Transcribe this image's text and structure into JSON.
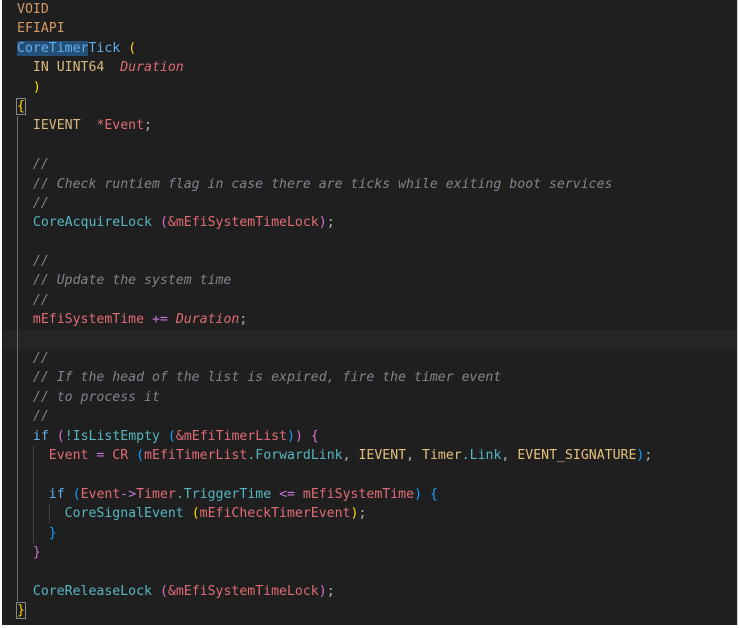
{
  "lines": [
    [
      {
        "t": "VOID",
        "c": "macro"
      }
    ],
    [
      {
        "t": "EFIAPI",
        "c": "macro"
      }
    ],
    [
      {
        "t": "CoreTimer",
        "c": "func-blue sel"
      },
      {
        "t": "Tick",
        "c": "func-blue"
      },
      {
        "t": " ",
        "c": "plain"
      },
      {
        "t": "(",
        "c": "punct-gold"
      }
    ],
    [
      {
        "t": "  IN UINT64  ",
        "c": "kw-type"
      },
      {
        "t": "Duration",
        "c": "param"
      }
    ],
    [
      {
        "t": "  ",
        "c": "plain"
      },
      {
        "t": ")",
        "c": "punct-gold"
      }
    ],
    [
      {
        "t": "{",
        "c": "punct-gold bracket-box"
      }
    ],
    [
      {
        "t": "  IEVENT  ",
        "c": "kw-type"
      },
      {
        "t": "*Event",
        "c": "var-red"
      },
      {
        "t": ";",
        "c": "plain"
      }
    ],
    [
      {
        "t": "",
        "c": "plain"
      }
    ],
    [
      {
        "t": "  //",
        "c": "comment"
      }
    ],
    [
      {
        "t": "  // Check runtiem flag in case there are ticks while exiting boot services",
        "c": "comment"
      }
    ],
    [
      {
        "t": "  //",
        "c": "comment"
      }
    ],
    [
      {
        "t": "  ",
        "c": "plain"
      },
      {
        "t": "CoreAcquireLock",
        "c": "func-teal"
      },
      {
        "t": " ",
        "c": "plain"
      },
      {
        "t": "(",
        "c": "punct-pink"
      },
      {
        "t": "&mEfiSystemTimeLock",
        "c": "var-red"
      },
      {
        "t": ")",
        "c": "punct-pink"
      },
      {
        "t": ";",
        "c": "plain"
      }
    ],
    [
      {
        "t": "",
        "c": "plain"
      }
    ],
    [
      {
        "t": "  //",
        "c": "comment"
      }
    ],
    [
      {
        "t": "  // Update the system time",
        "c": "comment"
      }
    ],
    [
      {
        "t": "  //",
        "c": "comment"
      }
    ],
    [
      {
        "t": "  ",
        "c": "plain"
      },
      {
        "t": "mEfiSystemTime",
        "c": "var-red"
      },
      {
        "t": " += ",
        "c": "op"
      },
      {
        "t": "Duration",
        "c": "param"
      },
      {
        "t": ";",
        "c": "plain"
      }
    ],
    [
      {
        "t": "",
        "c": "plain"
      }
    ],
    [
      {
        "t": "  //",
        "c": "comment"
      }
    ],
    [
      {
        "t": "  // If the head of the list is expired, fire the timer event",
        "c": "comment"
      }
    ],
    [
      {
        "t": "  // to process it",
        "c": "comment"
      }
    ],
    [
      {
        "t": "  //",
        "c": "comment"
      }
    ],
    [
      {
        "t": "  ",
        "c": "plain"
      },
      {
        "t": "if",
        "c": "func-blue"
      },
      {
        "t": " ",
        "c": "plain"
      },
      {
        "t": "(",
        "c": "punct-pink"
      },
      {
        "t": "!IsListEmpty",
        "c": "func-teal"
      },
      {
        "t": " ",
        "c": "plain"
      },
      {
        "t": "(",
        "c": "punct-blue"
      },
      {
        "t": "&mEfiTimerList",
        "c": "var-red"
      },
      {
        "t": ")",
        "c": "punct-blue"
      },
      {
        "t": ")",
        "c": "punct-pink"
      },
      {
        "t": " ",
        "c": "plain"
      },
      {
        "t": "{",
        "c": "punct-pink"
      }
    ],
    [
      {
        "t": "    ",
        "c": "plain"
      },
      {
        "t": "Event",
        "c": "var-red"
      },
      {
        "t": " = ",
        "c": "op"
      },
      {
        "t": "CR",
        "c": "var-red"
      },
      {
        "t": " ",
        "c": "plain"
      },
      {
        "t": "(",
        "c": "punct-blue"
      },
      {
        "t": "mEfiTimerList",
        "c": "var-red"
      },
      {
        "t": ".ForwardLink",
        "c": "func-teal"
      },
      {
        "t": ", ",
        "c": "plain"
      },
      {
        "t": "IEVENT",
        "c": "var"
      },
      {
        "t": ", ",
        "c": "plain"
      },
      {
        "t": "Timer",
        "c": "var"
      },
      {
        "t": ".Link",
        "c": "func-teal"
      },
      {
        "t": ", ",
        "c": "plain"
      },
      {
        "t": "EVENT_SIGNATURE",
        "c": "var"
      },
      {
        "t": ")",
        "c": "punct-blue"
      },
      {
        "t": ";",
        "c": "plain"
      }
    ],
    [
      {
        "t": "",
        "c": "plain"
      }
    ],
    [
      {
        "t": "    ",
        "c": "plain"
      },
      {
        "t": "if",
        "c": "func-blue"
      },
      {
        "t": " ",
        "c": "plain"
      },
      {
        "t": "(",
        "c": "punct-blue"
      },
      {
        "t": "Event",
        "c": "var-red"
      },
      {
        "t": "->",
        "c": "op"
      },
      {
        "t": "Timer",
        "c": "var-red"
      },
      {
        "t": ".TriggerTime",
        "c": "func-teal"
      },
      {
        "t": " <= ",
        "c": "op"
      },
      {
        "t": "mEfiSystemTime",
        "c": "var-red"
      },
      {
        "t": ")",
        "c": "punct-blue"
      },
      {
        "t": " ",
        "c": "plain"
      },
      {
        "t": "{",
        "c": "punct-blue"
      }
    ],
    [
      {
        "t": "      ",
        "c": "plain"
      },
      {
        "t": "CoreSignalEvent",
        "c": "func-teal"
      },
      {
        "t": " ",
        "c": "plain"
      },
      {
        "t": "(",
        "c": "punct-gold"
      },
      {
        "t": "mEfiCheckTimerEvent",
        "c": "var-red"
      },
      {
        "t": ")",
        "c": "punct-gold"
      },
      {
        "t": ";",
        "c": "plain"
      }
    ],
    [
      {
        "t": "    ",
        "c": "plain"
      },
      {
        "t": "}",
        "c": "punct-blue"
      }
    ],
    [
      {
        "t": "  ",
        "c": "plain"
      },
      {
        "t": "}",
        "c": "punct-pink"
      }
    ],
    [
      {
        "t": "",
        "c": "plain"
      }
    ],
    [
      {
        "t": "  ",
        "c": "plain"
      },
      {
        "t": "CoreReleaseLock",
        "c": "func-teal"
      },
      {
        "t": " ",
        "c": "plain"
      },
      {
        "t": "(",
        "c": "punct-pink"
      },
      {
        "t": "&mEfiSystemTimeLock",
        "c": "var-red"
      },
      {
        "t": ")",
        "c": "punct-pink"
      },
      {
        "t": ";",
        "c": "plain"
      }
    ],
    [
      {
        "t": "}",
        "c": "punct-gold bracket-box"
      }
    ]
  ],
  "current_line_index": 17,
  "colors": {
    "background": "#1f1f1f",
    "current_line": "#252526",
    "selection": "#264f78"
  }
}
